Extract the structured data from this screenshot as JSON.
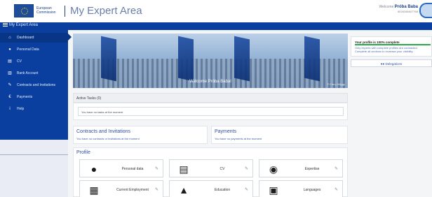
{
  "header": {
    "org_line1": "European",
    "org_line2": "Commission",
    "app_title": "My Expert Area",
    "welcome_prefix": "Welcome",
    "user_name": "Próba Baba",
    "user_id": "8026266607766"
  },
  "nav": {
    "menu_label": "My Expert Area"
  },
  "sidebar": {
    "items": [
      {
        "label": "Dashboard",
        "icon": "home-icon"
      },
      {
        "label": "Personal Data",
        "icon": "user-icon"
      },
      {
        "label": "CV",
        "icon": "id-card-icon"
      },
      {
        "label": "Bank Account",
        "icon": "bank-icon"
      },
      {
        "label": "Contracts and Invitations",
        "icon": "edit-icon"
      },
      {
        "label": "Payments",
        "icon": "euro-icon"
      },
      {
        "label": "Help",
        "icon": "info-icon"
      }
    ]
  },
  "hero": {
    "caption": "Welcome Próba Baba!",
    "credit": "© Ferry Wiggy"
  },
  "tasks": {
    "title": "Active Tasks (0)",
    "empty_message": "You have no tasks at the moment"
  },
  "contracts": {
    "title": "Contracts and Invitations",
    "subtitle": "You have no contracts or invitations at the moment"
  },
  "payments": {
    "title": "Payments",
    "subtitle": "You have no payments at the moment"
  },
  "profile": {
    "title": "Profile",
    "tiles": [
      {
        "label": "Personal data",
        "icon": "person-icon"
      },
      {
        "label": "CV",
        "icon": "id-card-icon"
      },
      {
        "label": "Expertise",
        "icon": "target-icon"
      },
      {
        "label": "Current Employment",
        "icon": "building-icon"
      },
      {
        "label": "Education",
        "icon": "graduation-cap-icon"
      },
      {
        "label": "Languages",
        "icon": "language-icon"
      }
    ]
  },
  "status": {
    "title": "Your profile is 100% complete",
    "completion": 1.0,
    "text": "Only experts with complete profiles are contracted. Complete all sections to increase your visibility.",
    "delegations_label": "Delegations"
  },
  "colors": {
    "brand_blue": "#0a3f9f",
    "link_blue": "#2f4f9c",
    "progress_green": "#2aa84a"
  }
}
